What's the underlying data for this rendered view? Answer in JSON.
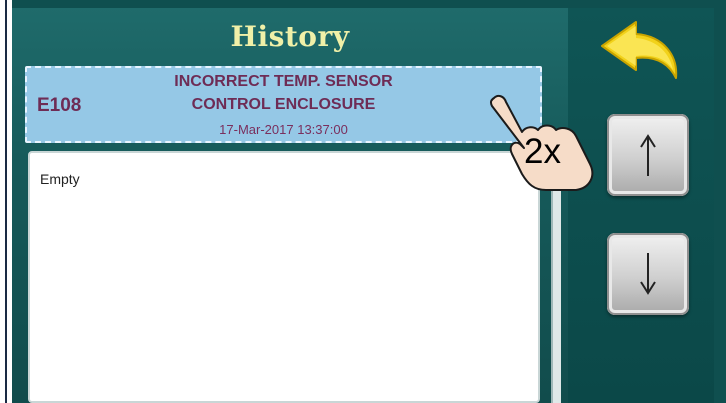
{
  "header": {
    "title": "History"
  },
  "history_entry": {
    "code": "E108",
    "message_line1": "INCORRECT TEMP. SENSOR",
    "message_line2": "CONTROL ENCLOSURE",
    "timestamp": "17-Mar-2017 13:37:00"
  },
  "history_list": {
    "empty_text": "Empty"
  },
  "gesture": {
    "tap_count_label": "2x",
    "icon": "hand-pointer-icon"
  },
  "nav": {
    "back_icon": "back-arrow-icon",
    "up_icon": "arrow-up-icon",
    "down_icon": "arrow-down-icon"
  },
  "colors": {
    "screen_bg": "#0f4f4f",
    "title_text": "#f0f0a8",
    "entry_bg": "#95c8e6",
    "entry_text": "#6e2c55",
    "back_arrow": "#f2d21a"
  }
}
